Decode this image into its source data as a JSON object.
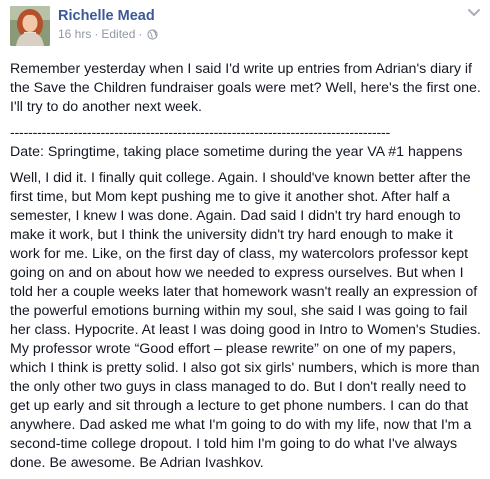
{
  "post": {
    "author": "Richelle Mead",
    "time": "16 hrs",
    "edited": "Edited",
    "dot": "·",
    "intro_lines": [
      "Remember yesterday when I said I'd write up entries from Adrian's diary if",
      "the Save the Children fundraiser goals were met? Well, here's the first one.",
      "I'll try to do another next week."
    ],
    "divider": "------------------------------------------------------------------------------------",
    "date_line": "Date: Springtime, taking place sometime during the year VA #1 happens",
    "story_lines": [
      "Well, I did it. I finally quit college. Again. I should've known better after the",
      "first time, but Mom kept pushing me to give it another shot. After half a",
      "semester, I knew I was done. Again. Dad said I didn't try hard enough to",
      "make it work, but I think the university didn't try hard enough to make it",
      "work for me. Like, on the first day of class, my watercolors professor kept",
      "going on and on about how we needed to express ourselves. But when I",
      "told her a couple weeks later that homework wasn't really an expression of",
      "the powerful emotions burning within my soul, she said I was going to fail",
      "her class. Hypocrite. At least I was doing good in Intro to Women's Studies.",
      "My professor wrote “Good effort – please rewrite” on one of my papers,",
      "which I think is pretty solid. I also got six girls' numbers, which is more than",
      "the only other two guys in class managed to do. But I don't really need to",
      "get up early and sit through a lecture to get phone numbers. I can do that",
      "anywhere. Dad asked me what I'm going to do with my life, now that I'm a",
      "second-time college dropout. I told him I'm going to do what I've always",
      "done. Be awesome. Be Adrian Ivashkov."
    ]
  },
  "icons": {
    "avatar": "profile-photo",
    "privacy": "globe-icon",
    "menu": "chevron-down-icon"
  },
  "colors": {
    "author": "#3b5998",
    "meta": "#9197a3",
    "text": "#141823"
  }
}
